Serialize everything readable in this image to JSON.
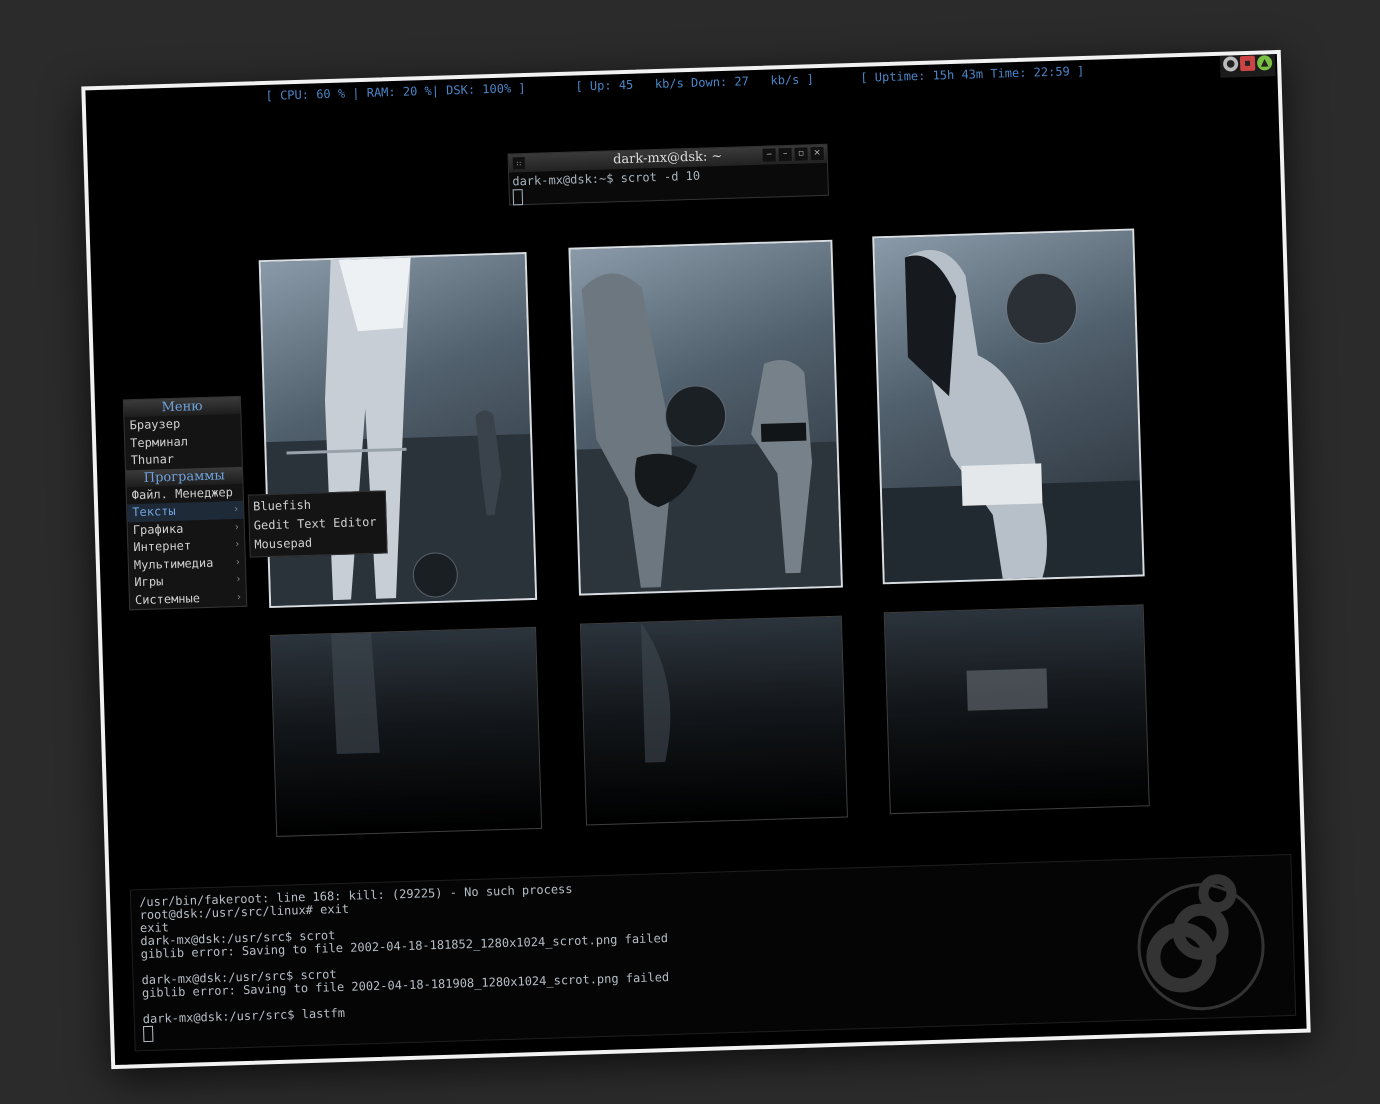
{
  "statusbar": {
    "sys": "[ CPU: 60 % | RAM: 20 %| DSK: 100% ]",
    "net": "[ Up: 45   kb/s Down: 27   kb/s ]",
    "time": "[ Uptime: 15h 43m Time: 22:59 ]"
  },
  "tray": {
    "icons": [
      "disc-icon",
      "battery-icon",
      "network-icon"
    ]
  },
  "terminal_small": {
    "title": "dark-mx@dsk: ~",
    "line1": "dark-mx@dsk:~$ scrot -d 10",
    "buttons": {
      "grip": "::",
      "shade": "‒",
      "minimize": "–",
      "maximize": "▫",
      "close": "×"
    }
  },
  "menu": {
    "header": "Меню",
    "top_items": [
      "Браузер",
      "Терминал",
      "Thunar"
    ],
    "section": "Программы",
    "items": [
      "Файл. Менеджер",
      "Тексты",
      "Графика",
      "Интернет",
      "Мультимедиа",
      "Игры",
      "Системные"
    ],
    "active_index": 1,
    "arrow": "›"
  },
  "submenu": {
    "items": [
      "Bluefish",
      "Gedit Text Editor",
      "Mousepad"
    ]
  },
  "terminal_bottom": {
    "lines": [
      "/usr/bin/fakeroot: line 168: kill: (29225) - No such process",
      "root@dsk:/usr/src/linux# exit",
      "exit",
      "dark-mx@dsk:/usr/src$ scrot",
      "giblib error: Saving to file 2002-04-18-181852_1280x1024_scrot.png failed",
      "",
      "dark-mx@dsk:/usr/src$ scrot",
      "giblib error: Saving to file 2002-04-18-181908_1280x1024_scrot.png failed",
      "",
      "dark-mx@dsk:/usr/src$ lastfm"
    ]
  },
  "colors": {
    "accent": "#6fa3dd",
    "background": "#000000",
    "frame": "#f2f2f2",
    "text": "#b6bec6"
  }
}
